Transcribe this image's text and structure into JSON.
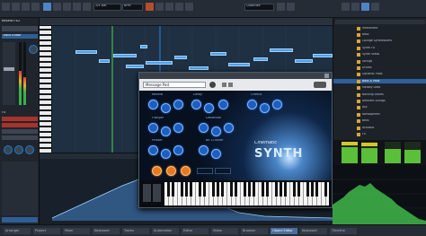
{
  "toolbar": {
    "field_1": "2/4 Bar",
    "field_2": "BPM",
    "tab_quantize": "Quantize"
  },
  "left_panel": {
    "header": "Reverb FX2",
    "track_section": "Track Editor",
    "fx_label": "FX"
  },
  "piano_roll": {
    "accent": "#4fa0e8"
  },
  "plugin": {
    "preset": "Message Pad",
    "product_line1": "Cinematic",
    "product_line2": "SYNTH",
    "sections": [
      "Reverb",
      "Delay",
      "Chorus",
      "Flanger",
      "Distortion",
      "Phaser",
      "Bit Crusher"
    ],
    "colors": {
      "knob_blue": "#1c5fbf",
      "knob_orange": "#e8791f"
    }
  },
  "browser": {
    "items": [
      "Instrument",
      "Bass",
      "Lounge Synthesizers",
      "Synth FX",
      "Synth Stabs",
      "Strings",
      "Drums",
      "Dynamic Pads",
      "Bass & Pads",
      "Melody Lead",
      "Backing Voices",
      "Ambient Strings",
      "Arp",
      "Atmospheric",
      "Bells",
      "Acoustic",
      "Fx"
    ],
    "selected_index": 8
  },
  "status_tabs": [
    "Arranger",
    "Project",
    "Mixer",
    "Keyboard",
    "Tracks",
    "Automation",
    "Editor",
    "Video",
    "Browser",
    "Object Editor",
    "Keyboard",
    "Timeline"
  ]
}
